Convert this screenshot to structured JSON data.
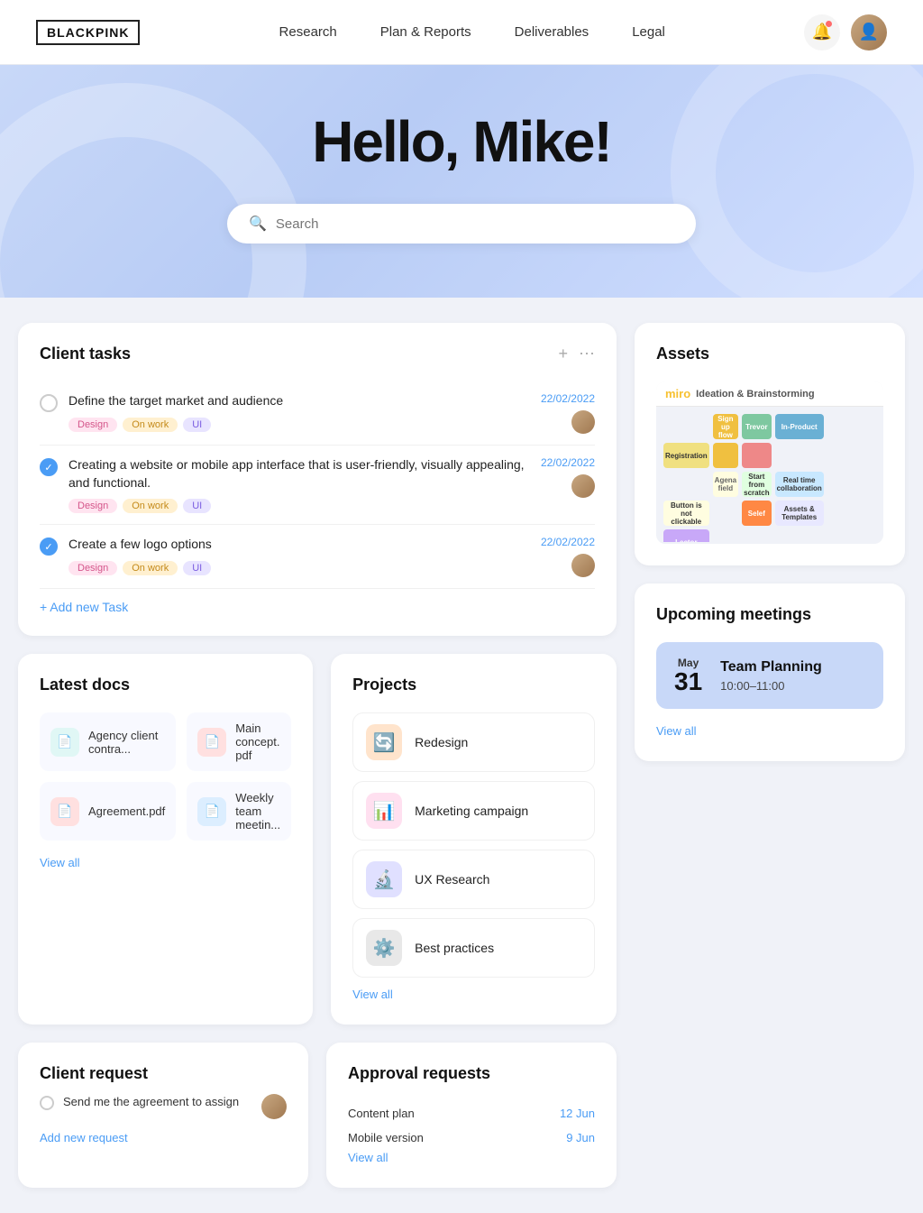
{
  "header": {
    "logo": "BLACKPINK",
    "nav": [
      {
        "id": "research",
        "label": "Research"
      },
      {
        "id": "plan-reports",
        "label": "Plan & Reports"
      },
      {
        "id": "deliverables",
        "label": "Deliverables"
      },
      {
        "id": "legal",
        "label": "Legal"
      }
    ]
  },
  "hero": {
    "greeting": "Hello, Mike!",
    "search_placeholder": "Search"
  },
  "client_tasks": {
    "title": "Client tasks",
    "add_label": "+ Add new Task",
    "tasks": [
      {
        "id": 1,
        "done": false,
        "text": "Define the target market and audience",
        "tags": [
          "Design",
          "On work",
          "UI"
        ],
        "date": "22/02/2022"
      },
      {
        "id": 2,
        "done": true,
        "text": "Creating a website or mobile app interface that is user-friendly, visually appealing, and functional.",
        "tags": [
          "Design",
          "On work",
          "UI"
        ],
        "date": "22/02/2022"
      },
      {
        "id": 3,
        "done": true,
        "text": "Create a few logo options",
        "tags": [
          "Design",
          "On work",
          "UI"
        ],
        "date": "22/02/2022"
      }
    ]
  },
  "assets": {
    "title": "Assets",
    "miro_label": "miro",
    "miro_subtitle": "Ideation & Brainstorming"
  },
  "latest_docs": {
    "title": "Latest docs",
    "view_all": "View all",
    "docs": [
      {
        "id": 1,
        "name": "Agency client contra...",
        "color": "#4ecdc4",
        "icon": "📄"
      },
      {
        "id": 2,
        "name": "Main concept. pdf",
        "color": "#ff6b6b",
        "icon": "📄"
      },
      {
        "id": 3,
        "name": "Agreement.pdf",
        "color": "#ff8c8c",
        "icon": "📄"
      },
      {
        "id": 4,
        "name": "Weekly team meetin...",
        "color": "#4a9cf5",
        "icon": "📄"
      }
    ]
  },
  "projects": {
    "title": "Projects",
    "view_all": "View all",
    "items": [
      {
        "id": 1,
        "name": "Redesign",
        "icon": "🔄",
        "bg": "#ffe4cc"
      },
      {
        "id": 2,
        "name": "Marketing campaign",
        "icon": "📊",
        "bg": "#ffe0f0"
      },
      {
        "id": 3,
        "name": "UX Research",
        "icon": "🔬",
        "bg": "#e0e0ff"
      },
      {
        "id": 4,
        "name": "Best practices",
        "icon": "⚙️",
        "bg": "#e8e8e8"
      }
    ]
  },
  "upcoming_meetings": {
    "title": "Upcoming meetings",
    "view_all": "View all",
    "meeting": {
      "month": "May",
      "day": "31",
      "name": "Team Planning",
      "time": "10:00–11:00"
    }
  },
  "client_request": {
    "title": "Client request",
    "request_text": "Send me the agreement to assign",
    "add_label": "Add new request"
  },
  "approval_requests": {
    "title": "Approval requests",
    "view_all": "View all",
    "items": [
      {
        "name": "Content plan",
        "date": "12 Jun"
      },
      {
        "name": "Mobile version",
        "date": "9 Jun"
      }
    ]
  }
}
